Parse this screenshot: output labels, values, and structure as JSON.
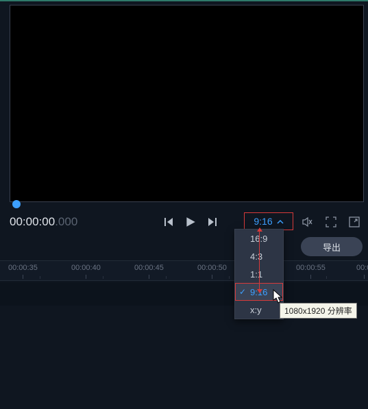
{
  "preview": {
    "timecode_main": "00:00:00",
    "timecode_ms": ".000",
    "aspect_ratio_selected": "9:16"
  },
  "aspect_ratio_menu": {
    "items": [
      "16:9",
      "4:3",
      "1:1",
      "9:16",
      "x:y"
    ],
    "selected_index": 3,
    "tooltip": "1080x1920 分辨率"
  },
  "export": {
    "label": "导出"
  },
  "timeline": {
    "ticks": [
      "00:00:35",
      "00:00:40",
      "00:00:45",
      "00:00:50",
      "00:00:55",
      "00:0"
    ]
  },
  "icons": {
    "prev": "prev-frame-icon",
    "play": "play-icon",
    "next": "next-frame-icon",
    "mute": "mute-icon",
    "fullscreen": "fullscreen-icon",
    "detach": "detach-window-icon",
    "caret_up": "chevron-up-icon"
  }
}
